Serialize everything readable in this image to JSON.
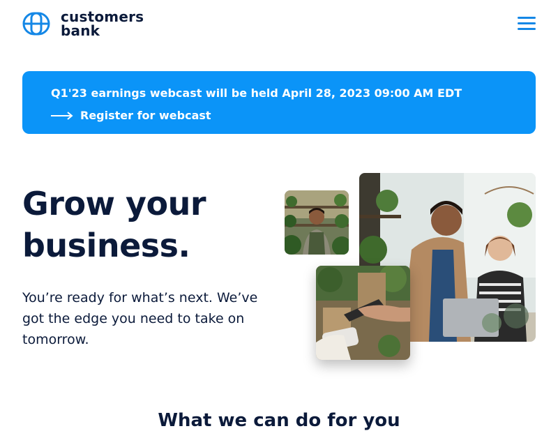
{
  "brand": {
    "line1": "customers",
    "line2": "bank",
    "logo_icon": "customers-bank-logo-icon",
    "color_primary": "#0b1a3a",
    "color_accent": "#1487e6"
  },
  "header": {
    "menu_icon": "hamburger-menu-icon"
  },
  "banner": {
    "title": "Q1'23 earnings webcast will be held April 28, 2023 09:00 AM EDT",
    "link_label": "Register for webcast",
    "link_icon": "arrow-right-icon",
    "background": "#0b94f8"
  },
  "hero": {
    "title": "Grow your business.",
    "subtitle": "You’re ready for what’s next. We’ve got the edge you need to take on tomorrow."
  },
  "images": {
    "small": "photo-shop-owner-smiling",
    "large": "photo-two-people-at-laptop",
    "mid": "photo-card-payment"
  },
  "next_section": {
    "title": "What we can do for you"
  }
}
